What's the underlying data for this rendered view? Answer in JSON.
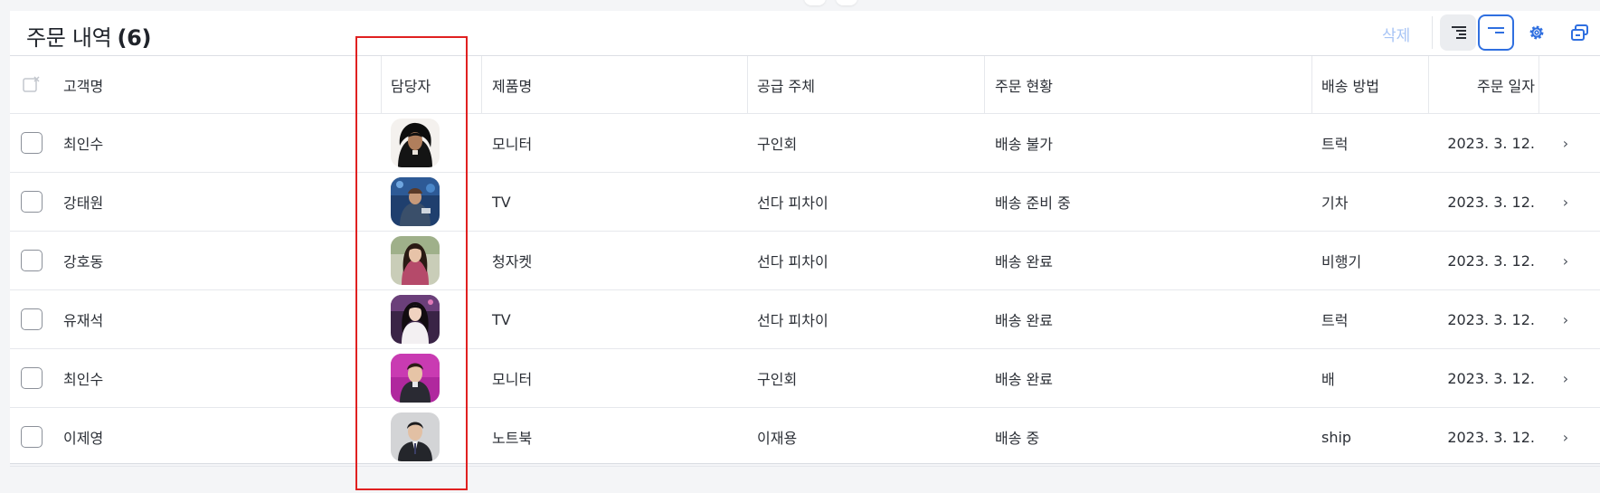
{
  "header": {
    "title": "주문 내역",
    "count": "(6)",
    "delete_label": "삭제"
  },
  "icons": {
    "grey_button": "align-right-lines-icon",
    "outlined_button": "align-right-collapsed-icon",
    "gear": "gear-icon",
    "layer": "layers-icon",
    "header_checkbox": "select-all-icon",
    "chevron": "chevron-right-icon"
  },
  "colors": {
    "accent": "#2f6fe0",
    "delete_disabled": "#a7c4f5",
    "highlight": "#e02020"
  },
  "table": {
    "columns": {
      "name": "고객명",
      "manager": "담당자",
      "product": "제품명",
      "supplier": "공급 주체",
      "status": "주문 현황",
      "method": "배송 방법",
      "date": "주문 일자"
    },
    "rows": [
      {
        "name": "최인수",
        "manager_avatar": "manager-photo-1",
        "product": "모니터",
        "supplier": "구인회",
        "status": "배송 불가",
        "method": "트럭",
        "date": "2023. 3. 12."
      },
      {
        "name": "강태원",
        "manager_avatar": "manager-photo-2",
        "product": "TV",
        "supplier": "선다 피차이",
        "status": "배송 준비 중",
        "method": "기차",
        "date": "2023. 3. 12."
      },
      {
        "name": "강호동",
        "manager_avatar": "manager-photo-3",
        "product": "청자켓",
        "supplier": "선다 피차이",
        "status": "배송 완료",
        "method": "비행기",
        "date": "2023. 3. 12."
      },
      {
        "name": "유재석",
        "manager_avatar": "manager-photo-4",
        "product": "TV",
        "supplier": "선다 피차이",
        "status": "배송 완료",
        "method": "트럭",
        "date": "2023. 3. 12."
      },
      {
        "name": "최인수",
        "manager_avatar": "manager-photo-5",
        "product": "모니터",
        "supplier": "구인회",
        "status": "배송 완료",
        "method": "배",
        "date": "2023. 3. 12."
      },
      {
        "name": "이제영",
        "manager_avatar": "manager-photo-6",
        "product": "노트북",
        "supplier": "이재용",
        "status": "배송 중",
        "method": "ship",
        "date": "2023. 3. 12."
      }
    ]
  }
}
